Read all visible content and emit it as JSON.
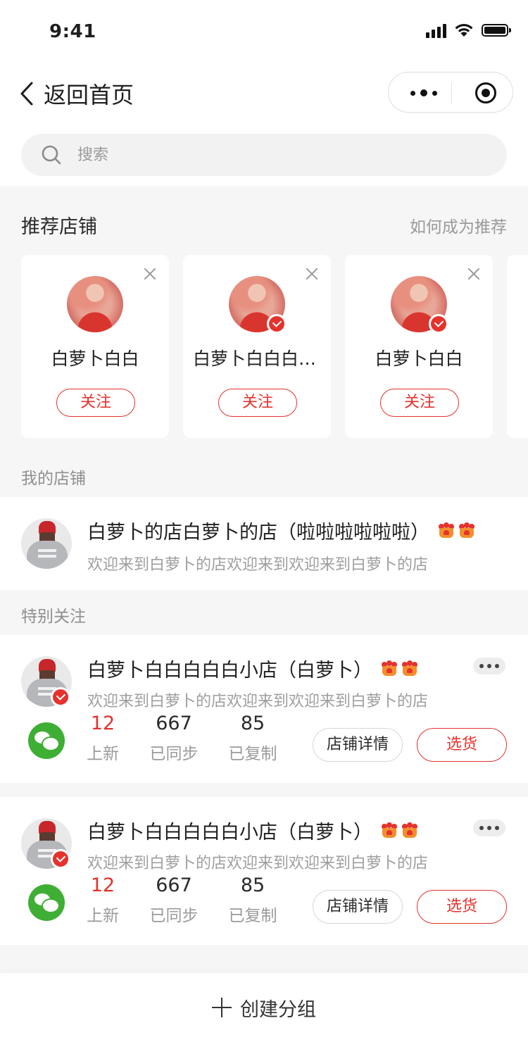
{
  "status_bar": {
    "time": "9:41"
  },
  "nav": {
    "back_label": "返回首页"
  },
  "search": {
    "placeholder": "搜索",
    "value": ""
  },
  "recommend": {
    "title": "推荐店铺",
    "link": "如何成为推荐",
    "cards": [
      {
        "name": "白萝卜白白",
        "follow_label": "关注",
        "verified": false
      },
      {
        "name": "白萝卜白白白白白",
        "follow_label": "关注",
        "verified": true
      },
      {
        "name": "白萝卜白白",
        "follow_label": "关注",
        "verified": true
      }
    ]
  },
  "my_shop": {
    "section_label": "我的店铺",
    "title": "白萝卜的店白萝卜的店（啦啦啦啦啦啦）",
    "desc": "欢迎来到白萝卜的店欢迎来到欢迎来到白萝卜的店"
  },
  "special": {
    "section_label": "特别关注",
    "shops": [
      {
        "title": "白萝卜白白白白白小店（白萝卜）",
        "desc": "欢迎来到白萝卜的店欢迎来到欢迎来到白萝卜的店",
        "stats": [
          {
            "value": "12",
            "label": "上新"
          },
          {
            "value": "667",
            "label": "已同步"
          },
          {
            "value": "85",
            "label": "已复制"
          }
        ],
        "detail_label": "店铺详情",
        "pick_label": "选货"
      },
      {
        "title": "白萝卜白白白白白小店（白萝卜）",
        "desc": "欢迎来到白萝卜的店欢迎来到欢迎来到白萝卜的店",
        "stats": [
          {
            "value": "12",
            "label": "上新"
          },
          {
            "value": "667",
            "label": "已同步"
          },
          {
            "value": "85",
            "label": "已复制"
          }
        ],
        "detail_label": "店铺详情",
        "pick_label": "选货"
      }
    ]
  },
  "bottom": {
    "create_label": "创建分组"
  },
  "colors": {
    "accent": "#e5322d",
    "wechat": "#3fae34",
    "background": "#f6f6f6"
  },
  "icons": [
    "back-chevron-icon",
    "more-dots-icon",
    "target-icon",
    "search-icon",
    "close-icon",
    "verified-badge-icon",
    "crown-icon",
    "wechat-icon",
    "plus-icon"
  ]
}
